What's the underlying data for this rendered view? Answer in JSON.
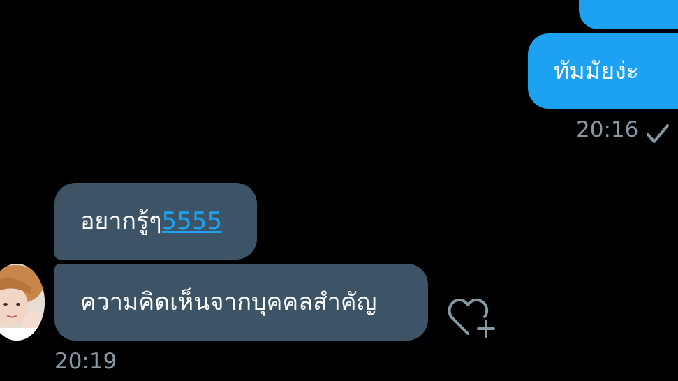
{
  "conversation": {
    "outgoing": [
      {
        "text": ""
      },
      {
        "text": "ทัมมัยง่ะ"
      }
    ],
    "outgoing_time": "20:16",
    "incoming": [
      {
        "text": "อยากรู้ๆ",
        "link": "5555"
      },
      {
        "text": "ความคิดเห็นจากบุคคลสำคัญ"
      }
    ],
    "incoming_time": "20:19"
  },
  "icons": {
    "read_receipt": "check-icon",
    "react": "heart-plus-icon",
    "avatar": "user-avatar"
  },
  "colors": {
    "background": "#000000",
    "outgoing_bubble": "#1da1f2",
    "incoming_bubble": "#3d5466",
    "meta_text": "#8899a6",
    "link": "#1da1f2"
  }
}
